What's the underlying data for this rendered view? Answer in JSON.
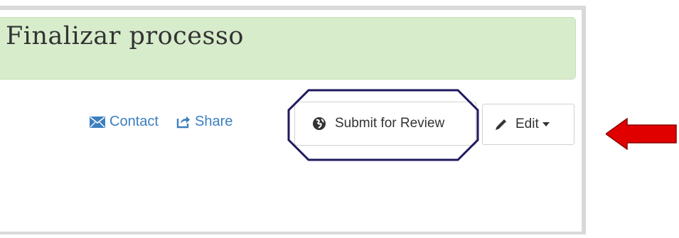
{
  "banner": {
    "title": "Finalizar processo"
  },
  "toolbar": {
    "contact_label": "Contact",
    "share_label": "Share",
    "submit_label": "Submit for Review",
    "edit_label": "Edit"
  },
  "icons": {
    "contact": "envelope-icon",
    "share": "share-icon",
    "submit": "globe-icon",
    "edit": "pencil-icon",
    "dropdown": "caret-down-icon"
  },
  "colors": {
    "banner_bg": "#d7eccb",
    "link": "#3c7fc0",
    "annotation_outline": "#1f1a5e",
    "annotation_arrow": "#e00000"
  }
}
